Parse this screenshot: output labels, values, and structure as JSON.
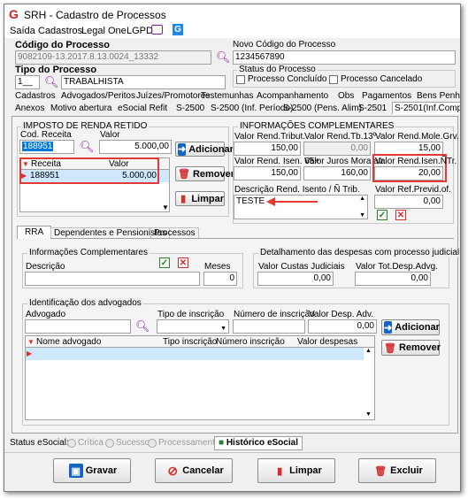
{
  "window": {
    "title": "SRH - Cadastro de Processos"
  },
  "menu": [
    "Saída",
    "Cadastros",
    "Legal One",
    "LGPD"
  ],
  "codigo_processo": {
    "label": "Código do Processo",
    "value": "9082109-13.2017.8.13.0024_13332"
  },
  "novo_codigo": {
    "label": "Novo Código do Processo",
    "value": "1234567890"
  },
  "tipo_processo": {
    "label": "Tipo do Processo",
    "code": "1__",
    "value": "TRABALHISTA"
  },
  "status_processo": {
    "label": "Status do Processo",
    "concluido": "Processo Concluído",
    "cancelado": "Processo Cancelado"
  },
  "tabs_row1": [
    "Cadastros",
    "Advogados/Peritos",
    "Juízes/Promotores",
    "Testemunhas",
    "Acompanhamento",
    "Obs",
    "Pagamentos",
    "Bens Penh"
  ],
  "tabs_row2": [
    "Anexos",
    "Motivo abertura",
    "eSocial Refit",
    "S-2500",
    "S-2500 (Inf. Período)",
    "S-2500 (Pens. Alim)",
    "S-2501",
    "S-2501(Inf.Compl)"
  ],
  "imposto": {
    "title": "IMPOSTO DE RENDA RETIDO",
    "cod_label": "Cod. Receita",
    "cod_value": "188951",
    "valor_label": "Valor",
    "valor_value": "5.000,00",
    "grid_headers": [
      "Receita",
      "Valor"
    ],
    "rows": [
      {
        "receita": "188951",
        "valor": "5.000,00"
      }
    ],
    "btn_adicionar": "Adicionar",
    "btn_remover": "Remover",
    "btn_limpar": "Limpar"
  },
  "info_comp": {
    "title": "INFORMAÇÕES COMPLEMENTARES",
    "f1": {
      "label": "Valor Rend.Tribut.",
      "value": "150,00"
    },
    "f2": {
      "label": "Valor Rend.Tb.13º",
      "value": "0,00"
    },
    "f3": {
      "label": "Valor Rend.Mole.Grv.",
      "value": "15,00"
    },
    "f4": {
      "label": "Valor Rend. Isen. 65+",
      "value": "150,00"
    },
    "f5": {
      "label": "Valor Juros Mora atr.",
      "value": "160,00"
    },
    "f6": {
      "label": "Valor Rend.Isen.ÑTr.",
      "value": "20,00"
    },
    "desc_label": "Descrição Rend. Isento / Ñ Trib.",
    "desc_value": "TESTE",
    "prev_label": "Valor Ref.Previd.of.",
    "prev_value": "0,00"
  },
  "subtabs": [
    "RRA",
    "Dependentes e Pensionistas",
    "Processos"
  ],
  "info_compl2": {
    "title": "Informações Complementares",
    "desc_label": "Descrição",
    "meses_label": "Meses",
    "meses_value": "0"
  },
  "despesas": {
    "title": "Detalhamento das despesas com processo judicial",
    "custas_label": "Valor Custas Judiciais",
    "custas_value": "0,00",
    "advg_label": "Valor Tot.Desp.Advg.",
    "advg_value": "0,00"
  },
  "advogados": {
    "title": "Identificação dos advogados",
    "adv_label": "Advogado",
    "tipo_label": "Tipo de inscrição",
    "num_label": "Número de inscrição",
    "desp_label": "Valor Desp. Adv.",
    "desp_value": "0,00",
    "grid_headers": [
      "Nome advogado",
      "Tipo inscrição",
      "Número inscrição",
      "Valor despesas"
    ],
    "btn_adicionar": "Adicionar",
    "btn_remover": "Remover"
  },
  "status_bar": {
    "label": "Status eSocial:",
    "critica": "Crítica",
    "sucesso": "Sucesso",
    "processamento": "Processamento",
    "historico": "Histórico eSocial"
  },
  "footer": {
    "gravar": "Gravar",
    "cancelar": "Cancelar",
    "limpar": "Limpar",
    "excluir": "Excluir"
  }
}
